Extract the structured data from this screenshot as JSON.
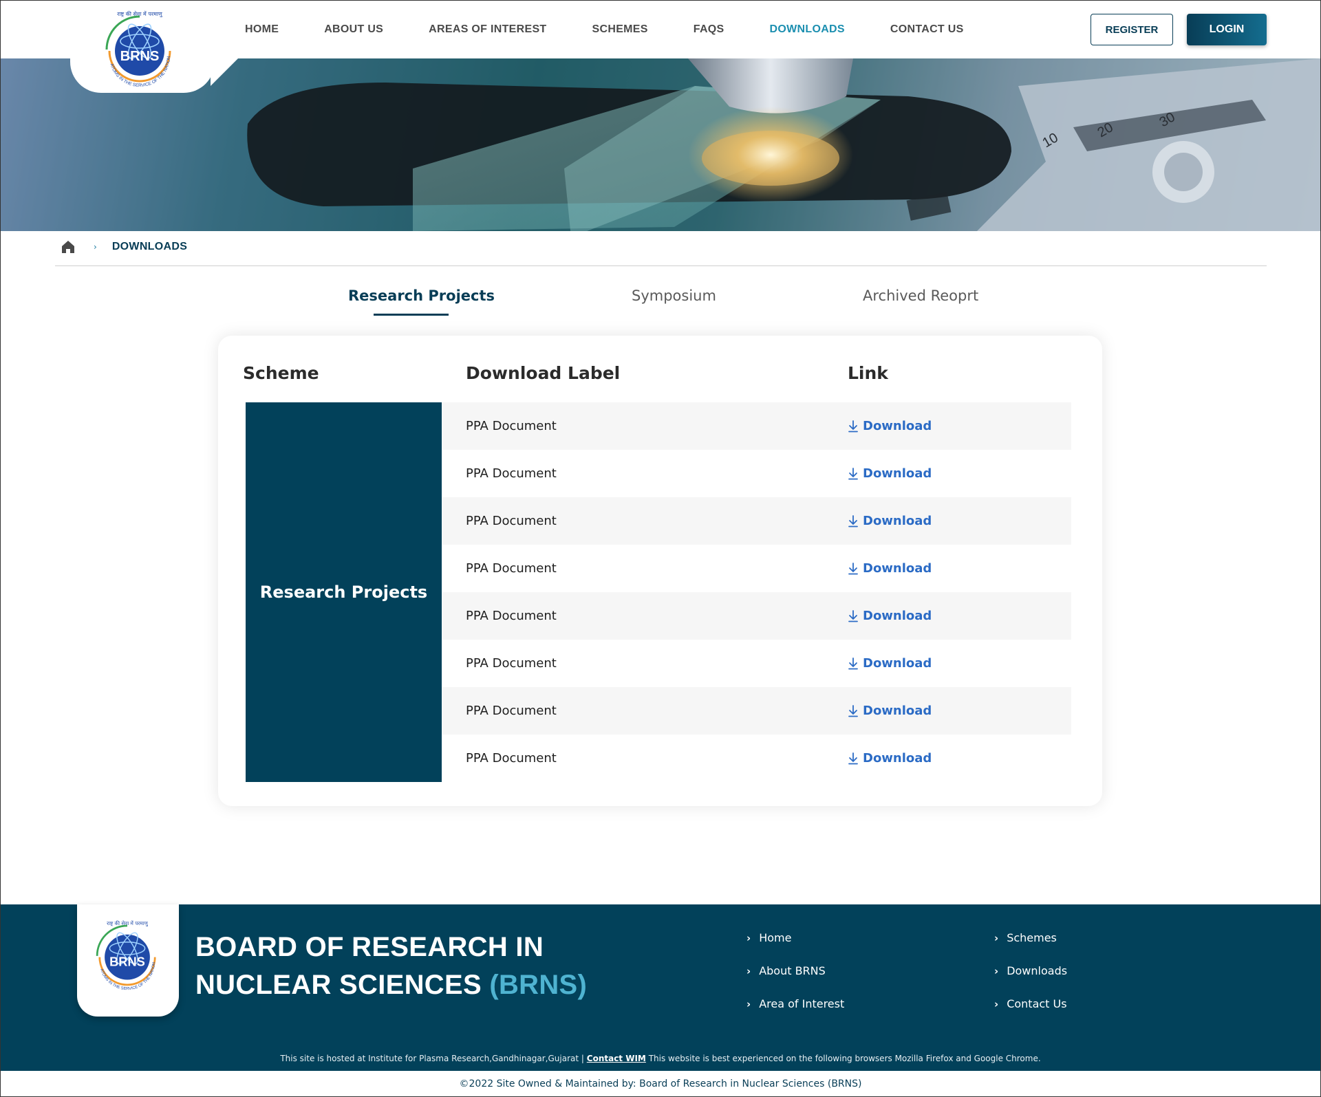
{
  "header": {
    "logo": {
      "hindi_text": "राष्ट्र की सेवा में परमाणु",
      "abbr": "BRNS",
      "tagline": "ATOMS IN THE SERVICE OF THE NATION"
    },
    "nav": [
      {
        "label": "HOME",
        "active": false
      },
      {
        "label": "ABOUT US",
        "active": false
      },
      {
        "label": "AREAS OF INTEREST",
        "active": false
      },
      {
        "label": "SCHEMES",
        "active": false
      },
      {
        "label": "FAQS",
        "active": false
      },
      {
        "label": "DOWNLOADS",
        "active": true
      },
      {
        "label": "CONTACT US",
        "active": false
      }
    ],
    "register_label": "REGISTER",
    "login_label": "LOGIN"
  },
  "breadcrumb": {
    "home_icon": "home-icon",
    "separator": "›",
    "current": "DOWNLOADS"
  },
  "tabs": [
    {
      "label": "Research Projects",
      "active": true
    },
    {
      "label": "Symposium",
      "active": false
    },
    {
      "label": "Archived Reoprt",
      "active": false
    }
  ],
  "table": {
    "headers": {
      "scheme": "Scheme",
      "label": "Download Label",
      "link": "Link"
    },
    "scheme_name": "Research Projects",
    "rows": [
      {
        "label": "PPA Document",
        "link": "Download"
      },
      {
        "label": "PPA Document",
        "link": "Download"
      },
      {
        "label": "PPA Document",
        "link": "Download"
      },
      {
        "label": "PPA Document",
        "link": "Download"
      },
      {
        "label": "PPA Document",
        "link": "Download"
      },
      {
        "label": "PPA Document",
        "link": "Download"
      },
      {
        "label": "PPA Document",
        "link": "Download"
      },
      {
        "label": "PPA Document",
        "link": "Download"
      }
    ],
    "link_icon": "download-icon"
  },
  "footer": {
    "title_line1": "BOARD OF RESEARCH IN",
    "title_line2": "NUCLEAR SCIENCES",
    "title_abbr": "(BRNS)",
    "links_col1": [
      "Home",
      "About BRNS",
      "Area of Interest"
    ],
    "links_col2": [
      "Schemes",
      "Downloads",
      "Contact Us"
    ],
    "note_prefix": "This site is hosted at Institute for Plasma Research,Gandhinagar,Gujarat  |",
    "note_link": "Contact WIM",
    "note_suffix": "This website is best experienced on the following browsers Mozilla Firefox and Google Chrome.",
    "copyright": "©2022 Site Owned & Maintained by: Board of Research in Nuclear Sciences (BRNS)"
  },
  "colors": {
    "primary": "#02415a",
    "accent": "#1c8fb0",
    "link": "#2b6bc5",
    "footer_abbr": "#4fb3d1"
  }
}
